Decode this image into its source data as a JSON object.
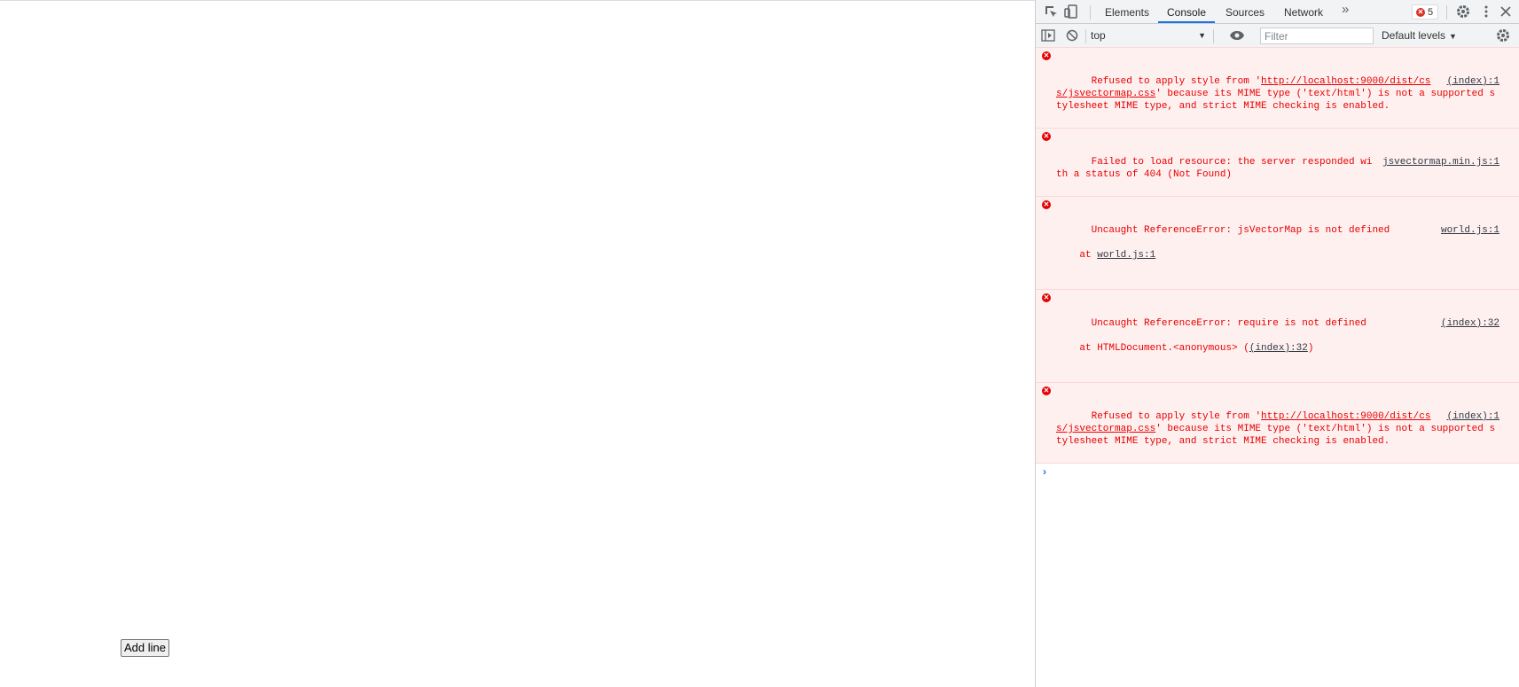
{
  "page": {
    "add_line_button": "Add line"
  },
  "devtools": {
    "tabs": [
      {
        "label": "Elements"
      },
      {
        "label": "Console"
      },
      {
        "label": "Sources"
      },
      {
        "label": "Network"
      }
    ],
    "active_tab": "Console",
    "more_tabs_glyph": "»",
    "error_count": "5",
    "toolbar": {
      "context": "top",
      "filter_placeholder": "Filter",
      "levels": "Default levels"
    },
    "messages": [
      {
        "text_a": "Refused to apply style from '",
        "link": "http://localhost:9000/dist/css/jsvectormap.css",
        "text_b": "' because its MIME type ('text/html') is not a supported stylesheet MIME type, and strict MIME checking is enabled.",
        "source": "(index):1"
      },
      {
        "text_a": "Failed to load resource: the server responded with a status of 404 (Not Found)",
        "source": "jsvectormap.min.js:1"
      },
      {
        "text_a": "Uncaught ReferenceError: jsVectorMap is not defined",
        "stack_prefix": "    at ",
        "stack_link": "world.js:1",
        "stack_suffix": "",
        "source": "world.js:1"
      },
      {
        "text_a": "Uncaught ReferenceError: require is not defined",
        "stack_prefix": "    at HTMLDocument.<anonymous> (",
        "stack_link": "(index):32",
        "stack_suffix": ")",
        "source": "(index):32"
      },
      {
        "text_a": "Refused to apply style from '",
        "link": "http://localhost:9000/dist/css/jsvectormap.css",
        "text_b": "' because its MIME type ('text/html') is not a supported stylesheet MIME type, and strict MIME checking is enabled.",
        "source": "(index):1"
      }
    ],
    "prompt_glyph": "›"
  },
  "colors": {
    "error_text": "#e60000",
    "error_bg": "#fff0f0",
    "active_tab_underline": "#1a73e8"
  }
}
